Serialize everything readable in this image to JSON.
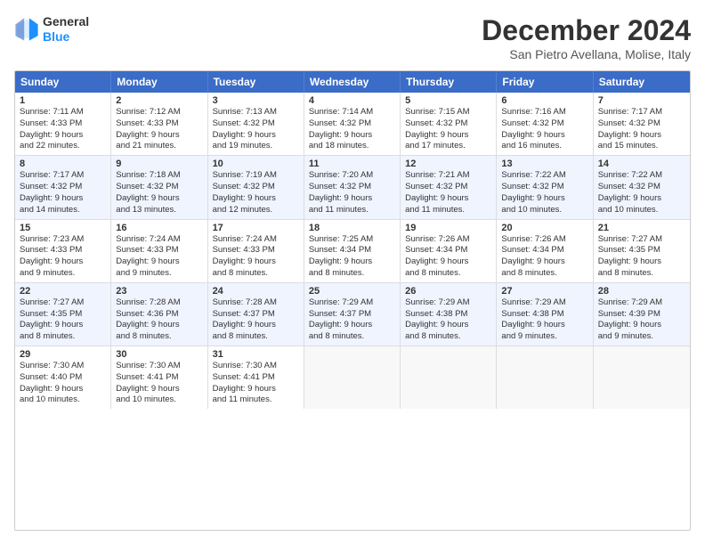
{
  "logo": {
    "line1": "General",
    "line2": "Blue"
  },
  "title": "December 2024",
  "subtitle": "San Pietro Avellana, Molise, Italy",
  "headers": [
    "Sunday",
    "Monday",
    "Tuesday",
    "Wednesday",
    "Thursday",
    "Friday",
    "Saturday"
  ],
  "rows": [
    [
      {
        "day": "1",
        "lines": [
          "Sunrise: 7:11 AM",
          "Sunset: 4:33 PM",
          "Daylight: 9 hours",
          "and 22 minutes."
        ]
      },
      {
        "day": "2",
        "lines": [
          "Sunrise: 7:12 AM",
          "Sunset: 4:33 PM",
          "Daylight: 9 hours",
          "and 21 minutes."
        ]
      },
      {
        "day": "3",
        "lines": [
          "Sunrise: 7:13 AM",
          "Sunset: 4:32 PM",
          "Daylight: 9 hours",
          "and 19 minutes."
        ]
      },
      {
        "day": "4",
        "lines": [
          "Sunrise: 7:14 AM",
          "Sunset: 4:32 PM",
          "Daylight: 9 hours",
          "and 18 minutes."
        ]
      },
      {
        "day": "5",
        "lines": [
          "Sunrise: 7:15 AM",
          "Sunset: 4:32 PM",
          "Daylight: 9 hours",
          "and 17 minutes."
        ]
      },
      {
        "day": "6",
        "lines": [
          "Sunrise: 7:16 AM",
          "Sunset: 4:32 PM",
          "Daylight: 9 hours",
          "and 16 minutes."
        ]
      },
      {
        "day": "7",
        "lines": [
          "Sunrise: 7:17 AM",
          "Sunset: 4:32 PM",
          "Daylight: 9 hours",
          "and 15 minutes."
        ]
      }
    ],
    [
      {
        "day": "8",
        "lines": [
          "Sunrise: 7:17 AM",
          "Sunset: 4:32 PM",
          "Daylight: 9 hours",
          "and 14 minutes."
        ]
      },
      {
        "day": "9",
        "lines": [
          "Sunrise: 7:18 AM",
          "Sunset: 4:32 PM",
          "Daylight: 9 hours",
          "and 13 minutes."
        ]
      },
      {
        "day": "10",
        "lines": [
          "Sunrise: 7:19 AM",
          "Sunset: 4:32 PM",
          "Daylight: 9 hours",
          "and 12 minutes."
        ]
      },
      {
        "day": "11",
        "lines": [
          "Sunrise: 7:20 AM",
          "Sunset: 4:32 PM",
          "Daylight: 9 hours",
          "and 11 minutes."
        ]
      },
      {
        "day": "12",
        "lines": [
          "Sunrise: 7:21 AM",
          "Sunset: 4:32 PM",
          "Daylight: 9 hours",
          "and 11 minutes."
        ]
      },
      {
        "day": "13",
        "lines": [
          "Sunrise: 7:22 AM",
          "Sunset: 4:32 PM",
          "Daylight: 9 hours",
          "and 10 minutes."
        ]
      },
      {
        "day": "14",
        "lines": [
          "Sunrise: 7:22 AM",
          "Sunset: 4:32 PM",
          "Daylight: 9 hours",
          "and 10 minutes."
        ]
      }
    ],
    [
      {
        "day": "15",
        "lines": [
          "Sunrise: 7:23 AM",
          "Sunset: 4:33 PM",
          "Daylight: 9 hours",
          "and 9 minutes."
        ]
      },
      {
        "day": "16",
        "lines": [
          "Sunrise: 7:24 AM",
          "Sunset: 4:33 PM",
          "Daylight: 9 hours",
          "and 9 minutes."
        ]
      },
      {
        "day": "17",
        "lines": [
          "Sunrise: 7:24 AM",
          "Sunset: 4:33 PM",
          "Daylight: 9 hours",
          "and 8 minutes."
        ]
      },
      {
        "day": "18",
        "lines": [
          "Sunrise: 7:25 AM",
          "Sunset: 4:34 PM",
          "Daylight: 9 hours",
          "and 8 minutes."
        ]
      },
      {
        "day": "19",
        "lines": [
          "Sunrise: 7:26 AM",
          "Sunset: 4:34 PM",
          "Daylight: 9 hours",
          "and 8 minutes."
        ]
      },
      {
        "day": "20",
        "lines": [
          "Sunrise: 7:26 AM",
          "Sunset: 4:34 PM",
          "Daylight: 9 hours",
          "and 8 minutes."
        ]
      },
      {
        "day": "21",
        "lines": [
          "Sunrise: 7:27 AM",
          "Sunset: 4:35 PM",
          "Daylight: 9 hours",
          "and 8 minutes."
        ]
      }
    ],
    [
      {
        "day": "22",
        "lines": [
          "Sunrise: 7:27 AM",
          "Sunset: 4:35 PM",
          "Daylight: 9 hours",
          "and 8 minutes."
        ]
      },
      {
        "day": "23",
        "lines": [
          "Sunrise: 7:28 AM",
          "Sunset: 4:36 PM",
          "Daylight: 9 hours",
          "and 8 minutes."
        ]
      },
      {
        "day": "24",
        "lines": [
          "Sunrise: 7:28 AM",
          "Sunset: 4:37 PM",
          "Daylight: 9 hours",
          "and 8 minutes."
        ]
      },
      {
        "day": "25",
        "lines": [
          "Sunrise: 7:29 AM",
          "Sunset: 4:37 PM",
          "Daylight: 9 hours",
          "and 8 minutes."
        ]
      },
      {
        "day": "26",
        "lines": [
          "Sunrise: 7:29 AM",
          "Sunset: 4:38 PM",
          "Daylight: 9 hours",
          "and 8 minutes."
        ]
      },
      {
        "day": "27",
        "lines": [
          "Sunrise: 7:29 AM",
          "Sunset: 4:38 PM",
          "Daylight: 9 hours",
          "and 9 minutes."
        ]
      },
      {
        "day": "28",
        "lines": [
          "Sunrise: 7:29 AM",
          "Sunset: 4:39 PM",
          "Daylight: 9 hours",
          "and 9 minutes."
        ]
      }
    ],
    [
      {
        "day": "29",
        "lines": [
          "Sunrise: 7:30 AM",
          "Sunset: 4:40 PM",
          "Daylight: 9 hours",
          "and 10 minutes."
        ]
      },
      {
        "day": "30",
        "lines": [
          "Sunrise: 7:30 AM",
          "Sunset: 4:41 PM",
          "Daylight: 9 hours",
          "and 10 minutes."
        ]
      },
      {
        "day": "31",
        "lines": [
          "Sunrise: 7:30 AM",
          "Sunset: 4:41 PM",
          "Daylight: 9 hours",
          "and 11 minutes."
        ]
      },
      {
        "day": "",
        "lines": []
      },
      {
        "day": "",
        "lines": []
      },
      {
        "day": "",
        "lines": []
      },
      {
        "day": "",
        "lines": []
      }
    ]
  ]
}
